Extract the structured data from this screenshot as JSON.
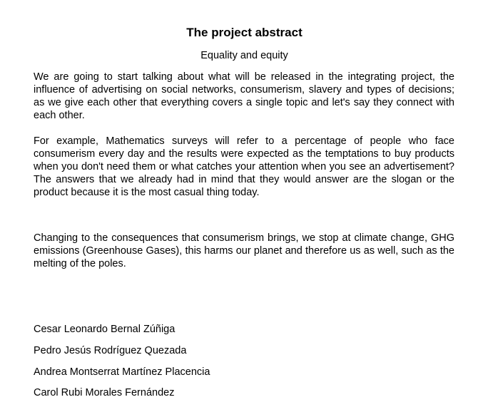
{
  "document": {
    "title": "The project abstract",
    "subtitle": "Equality and equity",
    "paragraphs": [
      "We are going to start talking about what will be released in the integrating project, the influence of advertising on social networks, consumerism, slavery and types of decisions; as we give each other that everything covers a single topic and let's say they connect with each other.",
      "For example, Mathematics surveys will refer to a percentage of people who face consumerism every day and the results were expected as the temptations to buy products when you don't need them or what catches your attention when you see an advertisement? The answers that we already had in mind that they would answer are the slogan or the product because it is the most casual thing today.",
      "Changing to the consequences that consumerism brings, we stop at climate change, GHG emissions (Greenhouse Gases), this harms our planet and therefore us as well, such as the melting of the poles."
    ],
    "authors": [
      "Cesar Leonardo Bernal Zúñiga",
      "Pedro Jesús Rodríguez Quezada",
      "Andrea Montserrat Martínez Placencia",
      "Carol Rubi Morales Fernández"
    ]
  }
}
